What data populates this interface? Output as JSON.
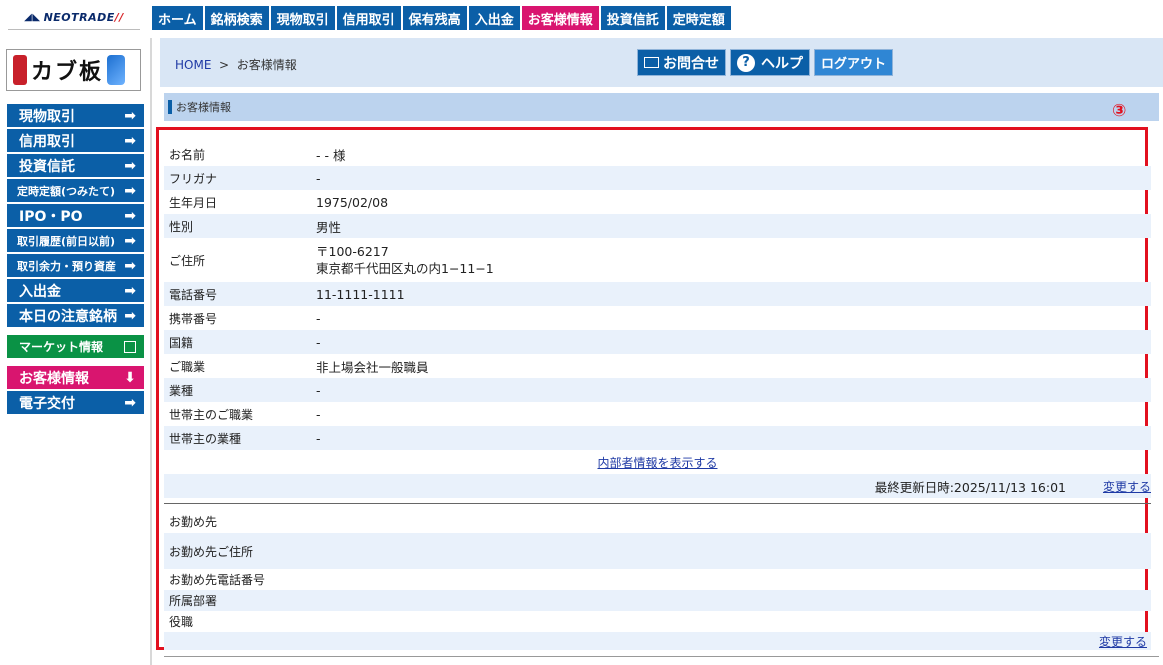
{
  "brand": {
    "neotrade": "NEOTRADE",
    "kabuban": "カブ板"
  },
  "global_nav": [
    "ホーム",
    "銘柄検索",
    "現物取引",
    "信用取引",
    "保有残高",
    "入出金",
    "お客様情報",
    "投資信託",
    "定時定額"
  ],
  "side_menu": [
    {
      "label": "現物取引",
      "icon": "arrow-right-icon"
    },
    {
      "label": "信用取引",
      "icon": "arrow-right-icon"
    },
    {
      "label": "投資信託",
      "icon": "arrow-right-icon"
    },
    {
      "label": "定時定額(つみたて)",
      "icon": "arrow-right-icon"
    },
    {
      "label": "IPO・PO",
      "icon": "arrow-right-icon"
    },
    {
      "label": "取引履歴(前日以前)",
      "icon": "arrow-right-icon"
    },
    {
      "label": "取引余力・預り資産",
      "icon": "arrow-right-icon"
    },
    {
      "label": "入出金",
      "icon": "arrow-right-icon"
    },
    {
      "label": "本日の注意銘柄",
      "icon": "arrow-right-icon"
    },
    {
      "label": "マーケット情報",
      "icon": "external-link-icon"
    },
    {
      "label": "お客様情報",
      "icon": "arrow-down-icon"
    },
    {
      "label": "電子交付",
      "icon": "arrow-right-icon"
    }
  ],
  "breadcrumb": {
    "home": "HOME",
    "sep": ">",
    "current": "お客様情報"
  },
  "header_buttons": {
    "contact": "お問合せ",
    "help": "ヘルプ",
    "logout": "ログアウト"
  },
  "section_title": "お客様情報",
  "annotation_marker": "③",
  "customer_info": [
    {
      "label": "お名前",
      "value": "-  -  様"
    },
    {
      "label": "フリガナ",
      "value": "-"
    },
    {
      "label": "生年月日",
      "value": "1975/02/08"
    },
    {
      "label": "性別",
      "value": "男性"
    },
    {
      "label": "ご住所",
      "value": "〒100-6217",
      "value2": "東京都千代田区丸の内1−11−1"
    },
    {
      "label": "電話番号",
      "value": "11-1111-1111"
    },
    {
      "label": "携帯番号",
      "value": "-"
    },
    {
      "label": "国籍",
      "value": "-"
    },
    {
      "label": "ご職業",
      "value": "非上場会社一般職員"
    },
    {
      "label": "業種",
      "value": "-"
    },
    {
      "label": "世帯主のご職業",
      "value": "-"
    },
    {
      "label": "世帯主の業種",
      "value": "-"
    }
  ],
  "insider_link": "内部者情報を表示する",
  "last_updated": "最終更新日時:2025/11/13 16:01",
  "change_link": "変更する",
  "employer_info": [
    {
      "label": "お勤め先"
    },
    {
      "label": "お勤め先ご住所"
    },
    {
      "label": "お勤め先電話番号"
    },
    {
      "label": "所属部署"
    },
    {
      "label": "役職"
    }
  ],
  "change_link2": "変更する"
}
